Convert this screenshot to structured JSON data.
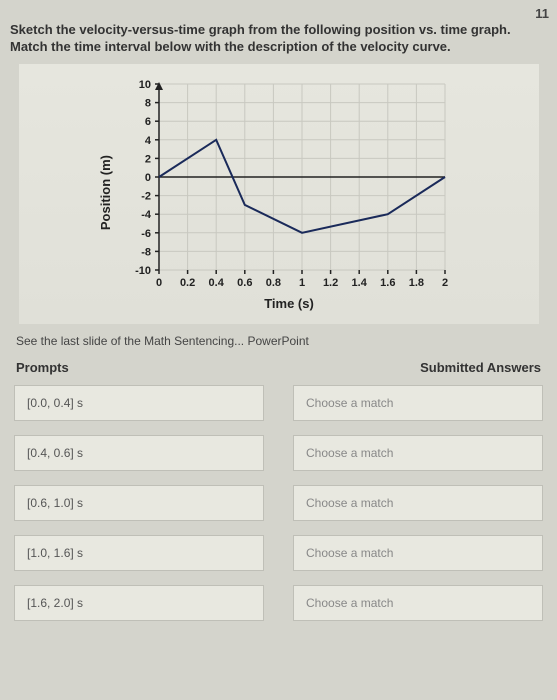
{
  "page_number": "11",
  "instructions": {
    "line1": "Sketch the velocity-versus-time graph from the following position vs. time graph.",
    "line2": "Match the time interval below with the description of the velocity curve."
  },
  "chart_data": {
    "type": "line",
    "title": "",
    "xlabel": "Time (s)",
    "ylabel": "Position (m)",
    "xlim": [
      0,
      2
    ],
    "ylim": [
      -10,
      10
    ],
    "xticks": [
      0,
      0.2,
      0.4,
      0.6,
      0.8,
      1,
      1.2,
      1.4,
      1.6,
      1.8,
      2
    ],
    "yticks": [
      -10,
      -8,
      -6,
      -4,
      -2,
      0,
      2,
      4,
      6,
      8,
      10
    ],
    "x": [
      0,
      0.4,
      0.6,
      1.0,
      1.6,
      2.0
    ],
    "y": [
      0,
      4,
      -3,
      -6,
      -4,
      0
    ]
  },
  "note": "See the last slide of the Math Sentencing... PowerPoint",
  "table_headers": {
    "prompts": "Prompts",
    "answers": "Submitted Answers"
  },
  "rows": [
    {
      "prompt": "[0.0, 0.4] s",
      "answer": "Choose a match"
    },
    {
      "prompt": "[0.4, 0.6] s",
      "answer": "Choose a match"
    },
    {
      "prompt": "[0.6, 1.0] s",
      "answer": "Choose a match"
    },
    {
      "prompt": "[1.0, 1.6] s",
      "answer": "Choose a match"
    },
    {
      "prompt": "[1.6, 2.0] s",
      "answer": "Choose a match"
    }
  ]
}
